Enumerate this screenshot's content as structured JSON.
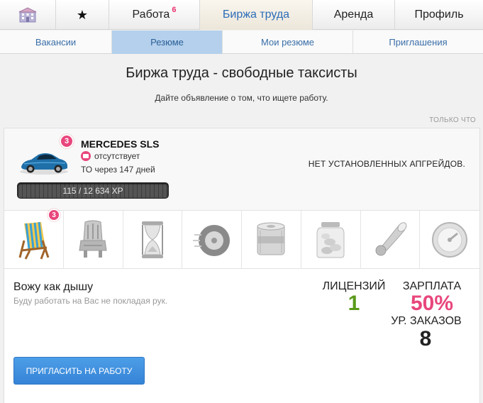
{
  "topnav": {
    "tabs": [
      {
        "label": "",
        "icon": "building-icon"
      },
      {
        "label": "",
        "icon": "star-icon"
      },
      {
        "label": "Работа",
        "badge": "6"
      },
      {
        "label": "Биржа труда",
        "active": true
      },
      {
        "label": "Аренда"
      },
      {
        "label": "Профиль"
      }
    ]
  },
  "subnav": {
    "tabs": [
      {
        "label": "Вакансии"
      },
      {
        "label": "Резюме",
        "active": true
      },
      {
        "label": "Мои резюме"
      },
      {
        "label": "Приглашения"
      }
    ]
  },
  "page": {
    "title": "Биржа труда - свободные таксисты",
    "subtitle": "Дайте объявление о том, что ищете работу.",
    "timestamp": "ТОЛЬКО ЧТО"
  },
  "resume": {
    "car": {
      "level_badge": "3",
      "name": "MERCEDES SLS",
      "inspection": "отсутствует",
      "maintenance": "ТО через 147 дней",
      "xp_text": "115 / 12 634 XP",
      "upgrades": "НЕТ УСТАНОВЛЕННЫХ АПГРЕЙДОВ."
    },
    "items": [
      {
        "icon": "beach-chair-icon",
        "badge": "3",
        "active": true
      },
      {
        "icon": "car-seat-icon"
      },
      {
        "icon": "hourglass-icon"
      },
      {
        "icon": "tire-icon"
      },
      {
        "icon": "money-roll-icon"
      },
      {
        "icon": "coin-jar-icon"
      },
      {
        "icon": "horn-icon"
      },
      {
        "icon": "speedometer-icon"
      }
    ],
    "driver_name": "Вожу как дышу",
    "motto": "Буду работать на Вас не покладая рук.",
    "licenses_label": "ЛИЦЕНЗИЙ",
    "licenses_value": "1",
    "salary_label": "ЗАРПЛАТА",
    "salary_value": "50%",
    "orders_label": "УР. ЗАКАЗОВ",
    "orders_value": "8",
    "invite_button": "ПРИГЛАСИТЬ НА РАБОТУ"
  },
  "colors": {
    "accent_blue": "#2b6cb8",
    "badge_pink": "#e8467c",
    "license_green": "#5a9a1a",
    "salary_pink": "#e8467c",
    "button_blue": "#3d8fe0"
  }
}
